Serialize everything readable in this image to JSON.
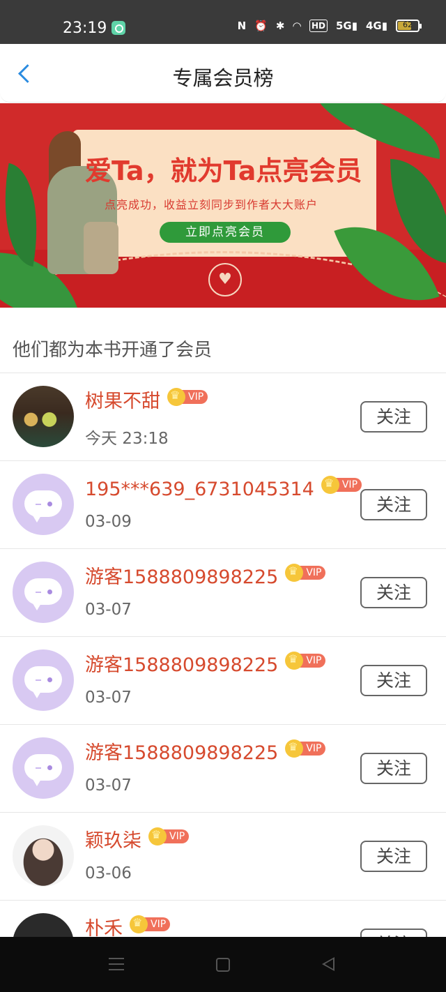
{
  "status_bar": {
    "time": "23:19",
    "network_5g": "5G",
    "network_4g": "4G",
    "hd": "HD",
    "battery": "62"
  },
  "header": {
    "title": "专属会员榜"
  },
  "banner": {
    "title": "爱Ta，就为Ta点亮会员",
    "subtitle": "点亮成功，收益立刻同步到作者大大账户",
    "button": "立即点亮会员"
  },
  "section": {
    "label": "他们都为本书开通了会员"
  },
  "members": [
    {
      "name": "树果不甜",
      "date": "今天 23:18",
      "vip": "VIP",
      "follow": "关注",
      "avatar": "photo1"
    },
    {
      "name": "195***639_6731045314",
      "date": "03-09",
      "vip": "VIP",
      "follow": "关注",
      "avatar": "default"
    },
    {
      "name": "游客1588809898225",
      "date": "03-07",
      "vip": "VIP",
      "follow": "关注",
      "avatar": "default"
    },
    {
      "name": "游客1588809898225",
      "date": "03-07",
      "vip": "VIP",
      "follow": "关注",
      "avatar": "default"
    },
    {
      "name": "游客1588809898225",
      "date": "03-07",
      "vip": "VIP",
      "follow": "关注",
      "avatar": "default"
    },
    {
      "name": "颖玖柒",
      "date": "03-06",
      "vip": "VIP",
      "follow": "关注",
      "avatar": "photo2"
    },
    {
      "name": "朴禾",
      "date": "",
      "vip": "VIP",
      "follow": "关注",
      "avatar": "photo3"
    }
  ],
  "colors": {
    "accent_blue": "#2a8be0",
    "name_red": "#d64a2e",
    "banner_red": "#d02a2a",
    "vip_tag": "#f0705a"
  }
}
